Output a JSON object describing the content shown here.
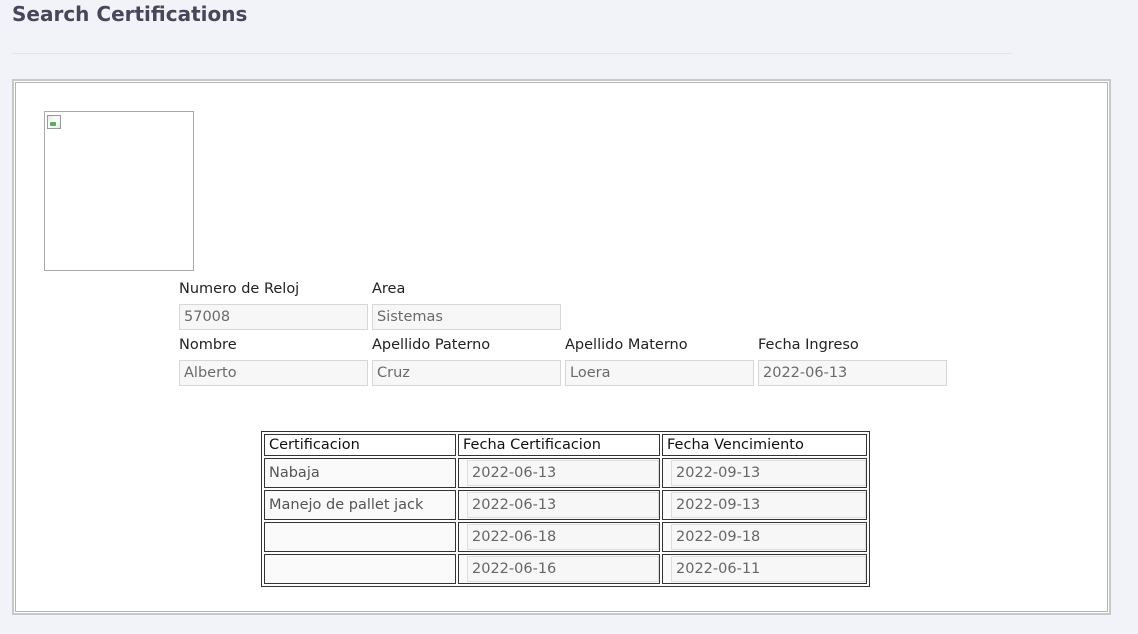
{
  "page": {
    "title": "Search Certifications"
  },
  "employee": {
    "fields": {
      "numero_reloj": {
        "label": "Numero de Reloj",
        "value": "57008"
      },
      "area": {
        "label": "Area",
        "value": "Sistemas"
      },
      "nombre": {
        "label": "Nombre",
        "value": "Alberto"
      },
      "apellido_paterno": {
        "label": "Apellido Paterno",
        "value": "Cruz"
      },
      "apellido_materno": {
        "label": "Apellido Materno",
        "value": "Loera"
      },
      "fecha_ingreso": {
        "label": "Fecha Ingreso",
        "value": "2022-06-13"
      }
    }
  },
  "certifications": {
    "headers": [
      "Certificacion",
      "Fecha Certificacion",
      "Fecha Vencimiento"
    ],
    "rows": [
      {
        "certificacion": "Nabaja",
        "fecha_certificacion": "2022-06-13",
        "fecha_vencimiento": "2022-09-13"
      },
      {
        "certificacion": "Manejo de pallet jack",
        "fecha_certificacion": "2022-06-13",
        "fecha_vencimiento": "2022-09-13"
      },
      {
        "certificacion": "",
        "fecha_certificacion": "2022-06-18",
        "fecha_vencimiento": "2022-09-18"
      },
      {
        "certificacion": "",
        "fecha_certificacion": "2022-06-16",
        "fecha_vencimiento": "2022-06-11"
      }
    ]
  },
  "icons": {
    "photo": "broken-image-icon"
  }
}
